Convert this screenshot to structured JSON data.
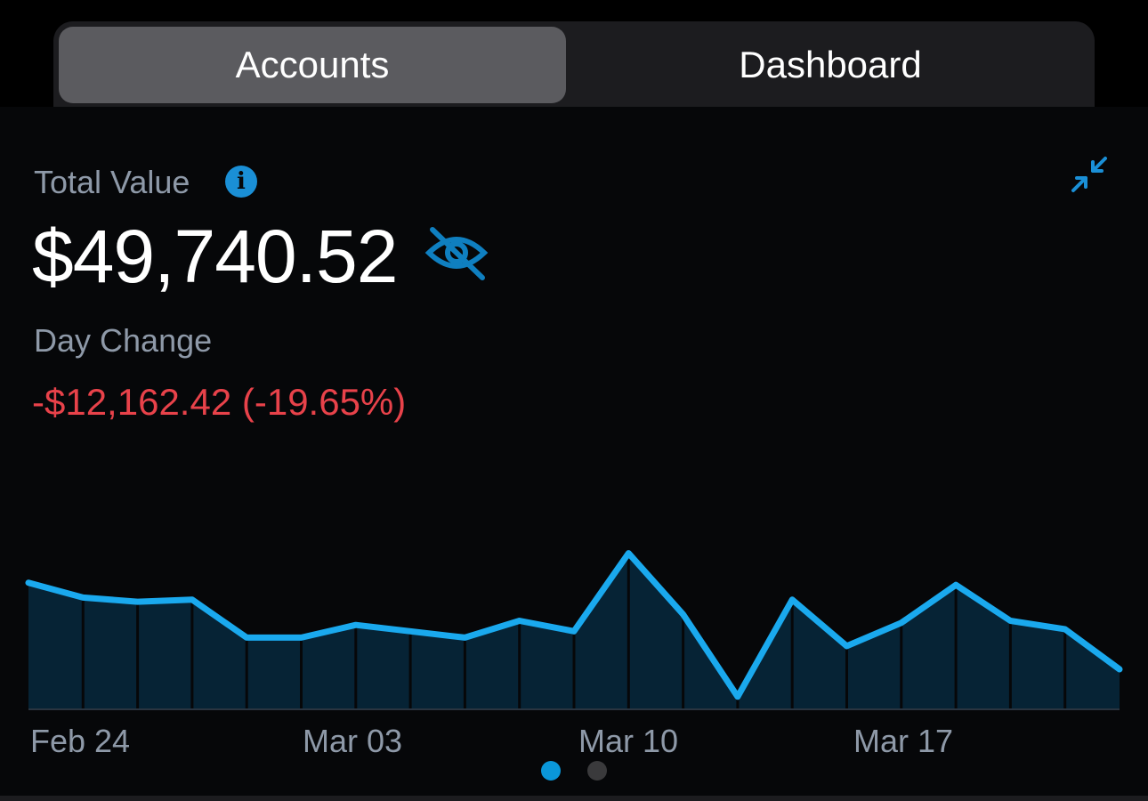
{
  "tabs": {
    "accounts_label": "Accounts",
    "dashboard_label": "Dashboard"
  },
  "summary": {
    "total_label": "Total Value",
    "total_value": "$49,740.52",
    "day_change_label": "Day Change",
    "day_change_value": "-$12,162.42 (-19.65%)"
  },
  "icons": {
    "info": "info-icon",
    "collapse": "collapse-icon",
    "hide": "eye-slash-icon"
  },
  "colors": {
    "accent": "#1aa9ee",
    "negative": "#e8424a",
    "active_dot": "#0a97d9"
  },
  "chart_data": {
    "type": "area",
    "xlabel": "",
    "ylabel": "",
    "x_tick_labels": [
      "Feb 24",
      "Mar 03",
      "Mar 10",
      "Mar 17"
    ],
    "grid": false,
    "values": [
      0.6,
      0.53,
      0.51,
      0.52,
      0.34,
      0.34,
      0.4,
      0.37,
      0.34,
      0.42,
      0.37,
      0.74,
      0.45,
      0.06,
      0.52,
      0.3,
      0.41,
      0.59,
      0.42,
      0.38,
      0.19
    ]
  },
  "pagination": {
    "pages": 2,
    "current": 1
  }
}
